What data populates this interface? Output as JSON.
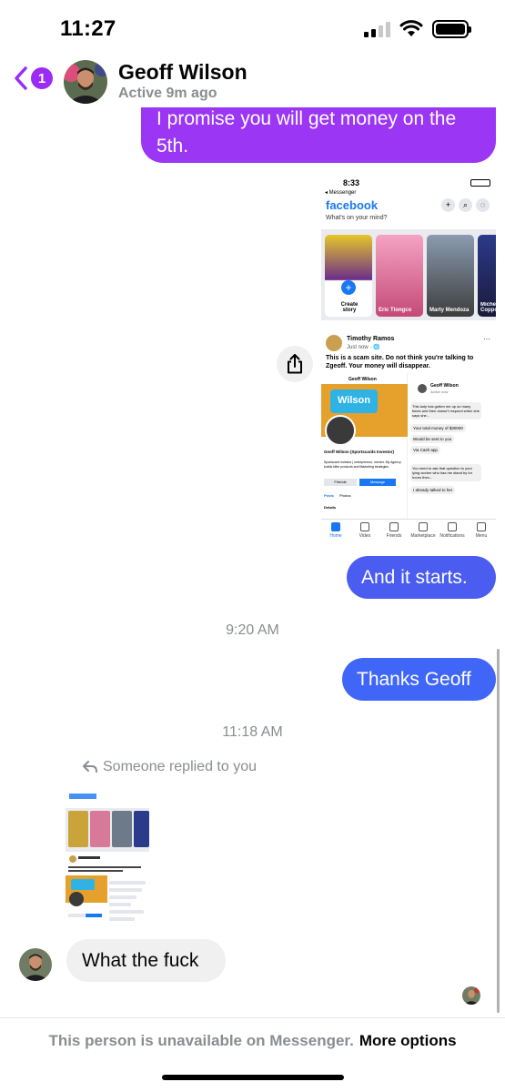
{
  "status_bar": {
    "time": "11:27"
  },
  "header": {
    "back_badge": "1",
    "contact_name": "Geoff Wilson",
    "contact_status": "Active 9m ago"
  },
  "messages": {
    "purple_text": "I promise you will get money on the 5th.",
    "blue1_text": "And it starts.",
    "blue2_text": "Thanks Geoff",
    "gray_text": "What the fuck"
  },
  "timestamps": {
    "t1": "9:20 AM",
    "t2": "11:18 AM"
  },
  "reply_label": "Someone replied to you",
  "attachment": {
    "time": "8:33",
    "back": "◂ Messenger",
    "app_name": "facebook",
    "mind_prompt": "What's on your mind?",
    "stories": [
      {
        "label": "Create story"
      },
      {
        "label": "Eric Tiongco"
      },
      {
        "label": "Marty Mendoza"
      },
      {
        "label": "Michelle Coppola"
      }
    ],
    "post_author": "Timothy Ramos",
    "post_time": "Just now · 🌐",
    "post_text": "This is a scam site. Do not think you're talking to Zgeoff. Your money will disappear.",
    "inner_profile_name": "Geoff Wilson",
    "inner_show_title": "Wilson",
    "inner_bio_name": "Geoff Wilson (Sportscards Investor)",
    "inner_bio": "Sportscard Investor | entrepreneur, mentor. My Agency builds killer products and Marketing strategies",
    "inner_friends": "Friends",
    "inner_message": "Message",
    "inner_tab_posts": "Posts",
    "inner_tab_photos": "Photos",
    "inner_details": "Details",
    "inner_chat_name": "Geoff Wilson",
    "inner_chat_status": "Active now",
    "inner_chat_lines": [
      "This lady has gotten me up so many times and then doesn't respond when she says she...",
      "Your total money of $30000",
      "Would be sent to you",
      "Via Cash app",
      "You need to ask that question to your lying worker who has me stand by for hours then...",
      "I already talked to her"
    ],
    "nav": [
      "Home",
      "Video",
      "Friends",
      "Marketplace",
      "Notifications",
      "Menu"
    ]
  },
  "footer": {
    "unavailable_text": "This person is unavailable on Messenger.",
    "more_options": "More options"
  },
  "colors": {
    "purple_bubble": "#9b36f5",
    "blue_bubble_1": "#4b5cf0",
    "blue_bubble_2": "#3f66f7",
    "facebook_blue": "#1877f2"
  }
}
